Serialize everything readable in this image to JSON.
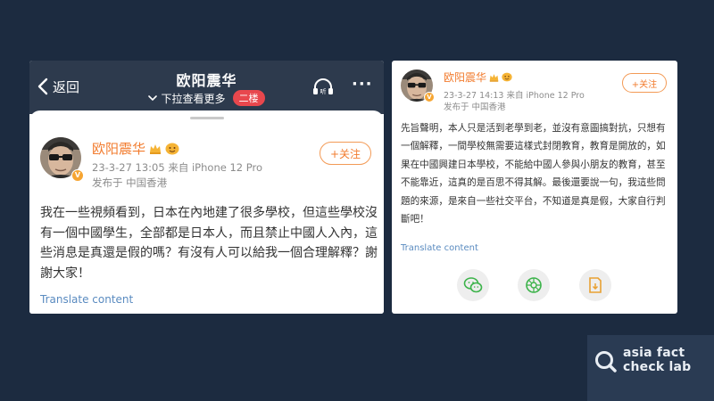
{
  "left_post": {
    "header": {
      "back_label": "返回",
      "title": "欧阳震华",
      "subtitle": "下拉查看更多",
      "floor_badge": "二楼",
      "more": "···"
    },
    "user": {
      "name": "欧阳震华",
      "avatar_badge": "V"
    },
    "meta_time_device": "23-3-27 13:05  来自 iPhone 12 Pro",
    "meta_location": "发布于  中国香港",
    "follow_label": "+关注",
    "body": "我在一些視頻看到，日本在內地建了很多學校，但這些學校沒有一個中國學生，全部都是日本人，而且禁止中國人入內，這些消息是真還是假的嗎？有沒有人可以給我一個合理解釋？謝謝大家！",
    "translate_label": "Translate content"
  },
  "right_post": {
    "user": {
      "name": "欧阳震华",
      "avatar_badge": "V"
    },
    "meta_time_device": "23-3-27 14:13  来自 iPhone 12 Pro",
    "meta_location": "发布于  中国香港",
    "follow_label": "+关注",
    "body": "先旨聲明，本人只是活到老學到老，並沒有意圖搞對抗，只想有一個解釋，一間學校無需要這樣式封閉教育，教育是開放的，如果在中國興建日本學校，不能給中國人參與小朋友的教育，甚至不能靠近，這真的是百思不得其解。最後還要說一句，我這些問題的來源，是來自一些社交平台，不知道是真是假，大家自行判斷吧！",
    "translate_label": "Translate content",
    "share_icons": [
      "wechat-icon",
      "moments-icon",
      "save-icon"
    ]
  },
  "watermark": {
    "line1": "asia fact",
    "line2": "check lab"
  },
  "colors": {
    "background": "#1c2b40",
    "topbar": "#2d3a4d",
    "username": "#f27c2f",
    "badge_red": "#e8474d",
    "link_blue": "#5a8bc0"
  }
}
